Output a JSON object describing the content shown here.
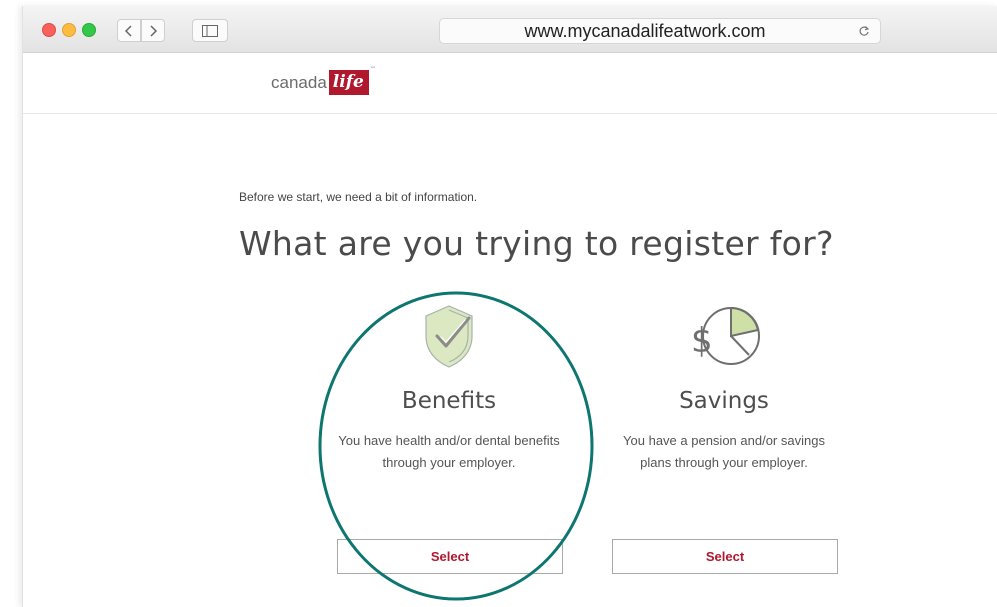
{
  "browser": {
    "url": "www.mycanadalifeatwork.com"
  },
  "logo": {
    "word": "canada",
    "mark": "life",
    "trademark": "™"
  },
  "intro_text": "Before we start, we need a bit of information.",
  "heading": "What are you trying to register for?",
  "options": [
    {
      "title": "Benefits",
      "description": "You have health and/or dental benefits through your employer.",
      "button_label": "Select",
      "icon": "shield-check-icon"
    },
    {
      "title": "Savings",
      "description": "You have a pension and/or savings plans through your employer.",
      "button_label": "Select",
      "icon": "dollar-pie-chart-icon"
    }
  ],
  "colors": {
    "brand_red": "#b0182e",
    "highlight_teal": "#0e7670",
    "icon_green": "#c9dca4"
  }
}
